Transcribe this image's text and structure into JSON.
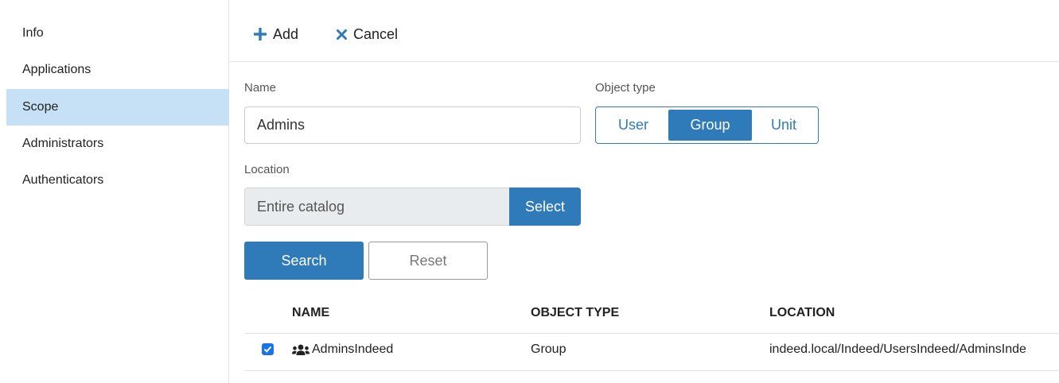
{
  "sidebar": {
    "items": [
      {
        "label": "Info"
      },
      {
        "label": "Applications"
      },
      {
        "label": "Scope",
        "active": true
      },
      {
        "label": "Administrators"
      },
      {
        "label": "Authenticators"
      }
    ]
  },
  "toolbar": {
    "add_label": "Add",
    "cancel_label": "Cancel",
    "add_icon": "plus-icon",
    "cancel_icon": "close-icon"
  },
  "form": {
    "name_label": "Name",
    "name_value": "Admins",
    "object_type_label": "Object type",
    "object_types": [
      "User",
      "Group",
      "Unit"
    ],
    "object_type_selected": "Group",
    "location_label": "Location",
    "location_value": "Entire catalog",
    "select_label": "Select",
    "search_label": "Search",
    "reset_label": "Reset"
  },
  "table": {
    "headers": [
      "NAME",
      "OBJECT TYPE",
      "LOCATION"
    ],
    "rows": [
      {
        "checked": true,
        "icon": "group-icon",
        "name": "AdminsIndeed",
        "object_type": "Group",
        "location": "indeed.local/Indeed/UsersIndeed/AdminsInde"
      }
    ]
  },
  "colors": {
    "accent": "#2f7ab9",
    "sidebar_active": "#c6e1f5",
    "checkbox": "#1a73e8"
  }
}
